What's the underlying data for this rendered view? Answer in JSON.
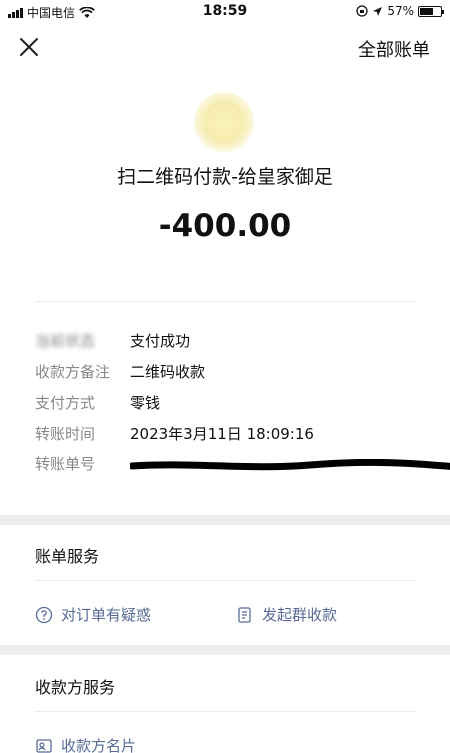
{
  "status_bar": {
    "carrier": "中国电信",
    "time": "18:59",
    "battery": "57%"
  },
  "nav": {
    "all_bills": "全部账单"
  },
  "merchant": {
    "title": "扫二维码付款-给皇家御足"
  },
  "amount": "-400.00",
  "details": [
    {
      "label": "当前状态",
      "value": "支付成功"
    },
    {
      "label": "收款方备注",
      "value": "二维码收款"
    },
    {
      "label": "支付方式",
      "value": "零钱"
    },
    {
      "label": "转账时间",
      "value": "2023年3月11日 18:09:16"
    },
    {
      "label": "转账单号",
      "value": ""
    }
  ],
  "bill_service": {
    "title": "账单服务",
    "items": [
      {
        "label": "对订单有疑惑",
        "icon": "question-icon"
      },
      {
        "label": "发起群收款",
        "icon": "group-collect-icon"
      }
    ]
  },
  "payee_service": {
    "title": "收款方服务",
    "items": [
      {
        "label": "收款方名片",
        "icon": "contact-card-icon"
      }
    ]
  },
  "colors": {
    "link": "#576b95",
    "label_gray": "#888888",
    "band_gray": "#ededed"
  }
}
